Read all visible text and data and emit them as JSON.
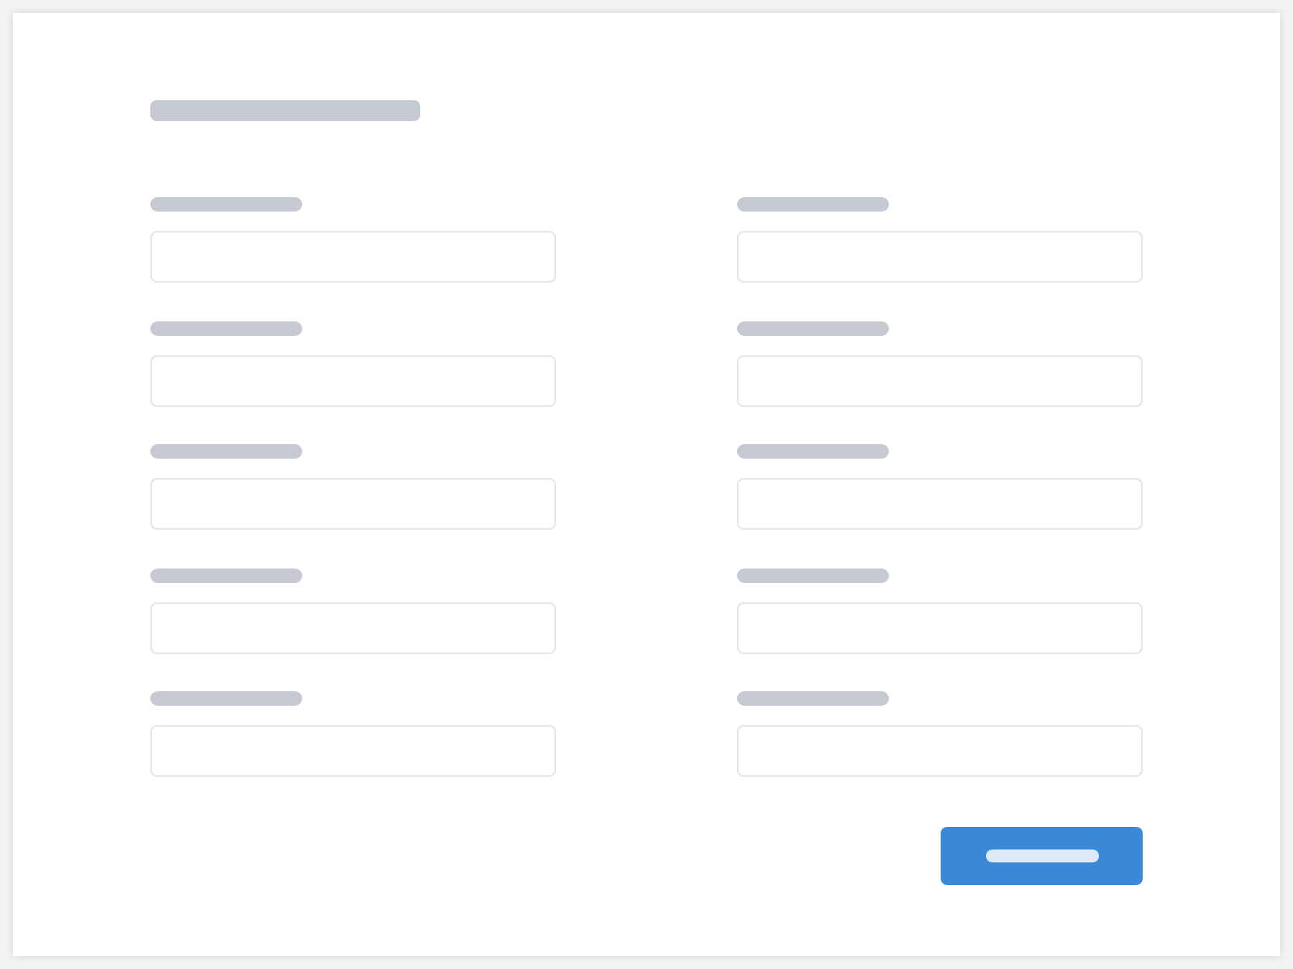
{
  "form": {
    "heading": {
      "kind": "skeleton-bar"
    },
    "columns": [
      {
        "fields": [
          {
            "label": {
              "kind": "skeleton-bar"
            },
            "input": {
              "kind": "text-box"
            }
          },
          {
            "label": {
              "kind": "skeleton-bar"
            },
            "input": {
              "kind": "text-box"
            }
          },
          {
            "label": {
              "kind": "skeleton-bar"
            },
            "input": {
              "kind": "text-box"
            }
          },
          {
            "label": {
              "kind": "skeleton-bar"
            },
            "input": {
              "kind": "text-box"
            }
          },
          {
            "label": {
              "kind": "skeleton-bar"
            },
            "input": {
              "kind": "text-box"
            }
          }
        ]
      },
      {
        "fields": [
          {
            "label": {
              "kind": "skeleton-bar"
            },
            "input": {
              "kind": "text-box"
            }
          },
          {
            "label": {
              "kind": "skeleton-bar"
            },
            "input": {
              "kind": "text-box"
            }
          },
          {
            "label": {
              "kind": "skeleton-bar"
            },
            "input": {
              "kind": "text-box"
            }
          },
          {
            "label": {
              "kind": "skeleton-bar"
            },
            "input": {
              "kind": "text-box"
            }
          },
          {
            "label": {
              "kind": "skeleton-bar"
            },
            "input": {
              "kind": "text-box"
            }
          }
        ]
      }
    ],
    "actions": [
      {
        "kind": "primary-button",
        "label": {
          "kind": "skeleton-bar"
        }
      }
    ]
  }
}
